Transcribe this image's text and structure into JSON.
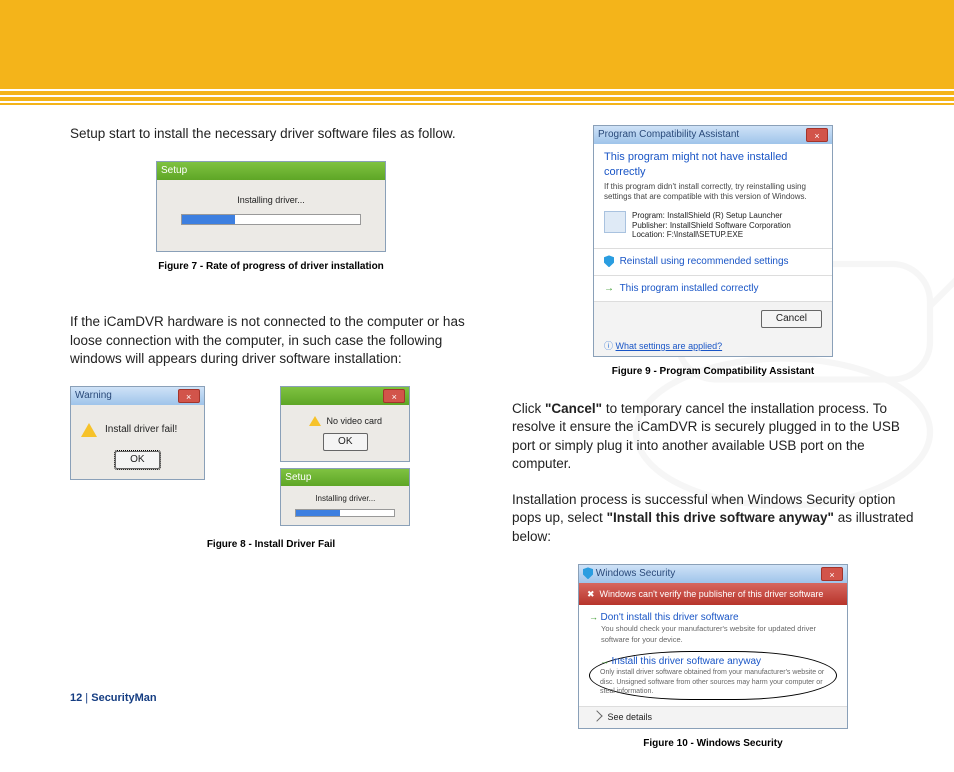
{
  "text": {
    "intro": "Setup start to install the necessary driver software files as follow.",
    "notConnected": "If the iCamDVR hardware is not connected to the computer or has loose connection with the computer, in such case the following windows will appears during driver software installation:",
    "clickCancel1": "Click ",
    "clickCancelBold": "\"Cancel\"",
    "clickCancel2": " to temporary cancel the installation process.  To resolve it ensure the iCamDVR is securely plugged in to the USB port or simply plug it into another available USB port on the computer.",
    "successful1": "Installation process is successful when Windows Security option pops up, select ",
    "successfulBold": "\"Install this drive software anyway\"",
    "successful2": " as illustrated below:"
  },
  "figs": {
    "f7": {
      "caption": "Figure 7 - Rate of progress of driver installation",
      "title": "Setup",
      "status": "Installing driver..."
    },
    "f8": {
      "caption": "Figure 8 - Install Driver Fail",
      "warning": {
        "title": "Warning",
        "message": "Install driver fail!",
        "ok": "OK"
      },
      "novideo": {
        "message": "No video card",
        "ok": "OK"
      },
      "setup": {
        "title": "Setup",
        "status": "Installing driver..."
      }
    },
    "f9": {
      "caption": "Figure 9 -  Program Compatibility Assistant",
      "title": "Program Compatibility Assistant",
      "heading": "This program might not have installed correctly",
      "sub": "If this program didn't install correctly, try reinstalling using settings that are compatible with this version of Windows.",
      "programLabel": "Program:",
      "programValue": "InstallShield (R) Setup Launcher",
      "publisherLabel": "Publisher:",
      "publisherValue": "InstallShield Software Corporation",
      "locationLabel": "Location:",
      "locationValue": "F:\\Install\\SETUP.EXE",
      "opt1": "Reinstall using recommended settings",
      "opt2": "This program installed correctly",
      "cancel": "Cancel",
      "help": "What settings are applied?"
    },
    "f10": {
      "caption": "Figure 10 -  Windows Security",
      "title": "Windows Security",
      "banner": "Windows can't verify the publisher of this driver software",
      "opt1": "Don't install this driver software",
      "opt1sub": "You should check your manufacturer's website for updated driver software for your device.",
      "opt2": "Install this driver software anyway",
      "opt2sub": "Only install driver software obtained from your manufacturer's website or disc. Unsigned software from other sources may harm your computer or steal information.",
      "details": "See details"
    }
  },
  "footer": {
    "page": "12",
    "sep": "  |  ",
    "brand": "SecurityMan"
  }
}
